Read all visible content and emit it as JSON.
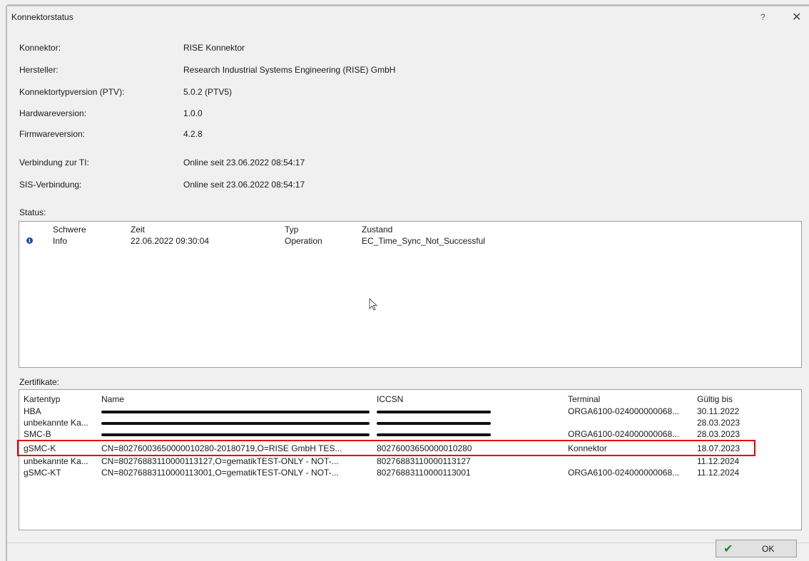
{
  "window": {
    "title": "Konnektorstatus",
    "help_label": "?",
    "close_label": "✕"
  },
  "info": [
    {
      "label": "Konnektor:",
      "value": "RISE Konnektor"
    },
    {
      "label": "Hersteller:",
      "value": "Research Industrial Systems Engineering (RISE) GmbH"
    },
    {
      "label": "Konnektortypversion (PTV):",
      "value": "5.0.2 (PTV5)"
    },
    {
      "label": "Hardwareversion:",
      "value": "1.0.0"
    },
    {
      "label": "Firmwareversion:",
      "value": "4.2.8"
    },
    {
      "label": "Verbindung zur TI:",
      "value": "Online seit 23.06.2022 08:54:17"
    },
    {
      "label": "SIS-Verbindung:",
      "value": "Online seit 23.06.2022 08:54:17"
    }
  ],
  "status": {
    "section_label": "Status:",
    "headers": {
      "schwere": "Schwere",
      "zeit": "Zeit",
      "typ": "Typ",
      "zustand": "Zustand"
    },
    "rows": [
      {
        "icon": "info-icon",
        "schwere": "Info",
        "zeit": "22.06.2022 09:30:04",
        "typ": "Operation",
        "zustand": "EC_Time_Sync_Not_Successful"
      }
    ]
  },
  "zertifikate": {
    "section_label": "Zertifikate:",
    "headers": {
      "kartentyp": "Kartentyp",
      "name": "Name",
      "iccsn": "ICCSN",
      "terminal": "Terminal",
      "gueltig": "Gültig bis"
    },
    "rows": [
      {
        "kartentyp": "HBA",
        "name": "",
        "iccsn": "",
        "terminal": "ORGA6100-024000000068...",
        "gueltig": "30.11.2022",
        "redacted": true
      },
      {
        "kartentyp": "unbekannte Ka...",
        "name": "",
        "iccsn": "",
        "terminal": "",
        "gueltig": "28.03.2023",
        "redacted": true
      },
      {
        "kartentyp": "SMC-B",
        "name": "",
        "iccsn": "",
        "terminal": "ORGA6100-024000000068...",
        "gueltig": "28.03.2023",
        "redacted": true
      },
      {
        "kartentyp": "gSMC-K",
        "name": "CN=80276003650000010280-20180719,O=RISE GmbH TES...",
        "iccsn": "80276003650000010280",
        "terminal": "Konnektor",
        "gueltig": "18.07.2023",
        "highlighted": true
      },
      {
        "kartentyp": "unbekannte Ka...",
        "name": "CN=80276883110000113127,O=gematikTEST-ONLY - NOT-...",
        "iccsn": "80276883110000113127",
        "terminal": "",
        "gueltig": "11.12.2024"
      },
      {
        "kartentyp": "gSMC-KT",
        "name": "CN=80276883110000113001,O=gematikTEST-ONLY - NOT-...",
        "iccsn": "80276883110000113001",
        "terminal": "ORGA6100-024000000068...",
        "gueltig": "11.12.2024"
      }
    ]
  },
  "buttons": {
    "ok_label": "OK",
    "ok_icon": "checkmark-icon"
  },
  "colors": {
    "highlight": "#e00000",
    "info_icon": "#1a4aa3",
    "ok_check": "#1c8a1c"
  }
}
